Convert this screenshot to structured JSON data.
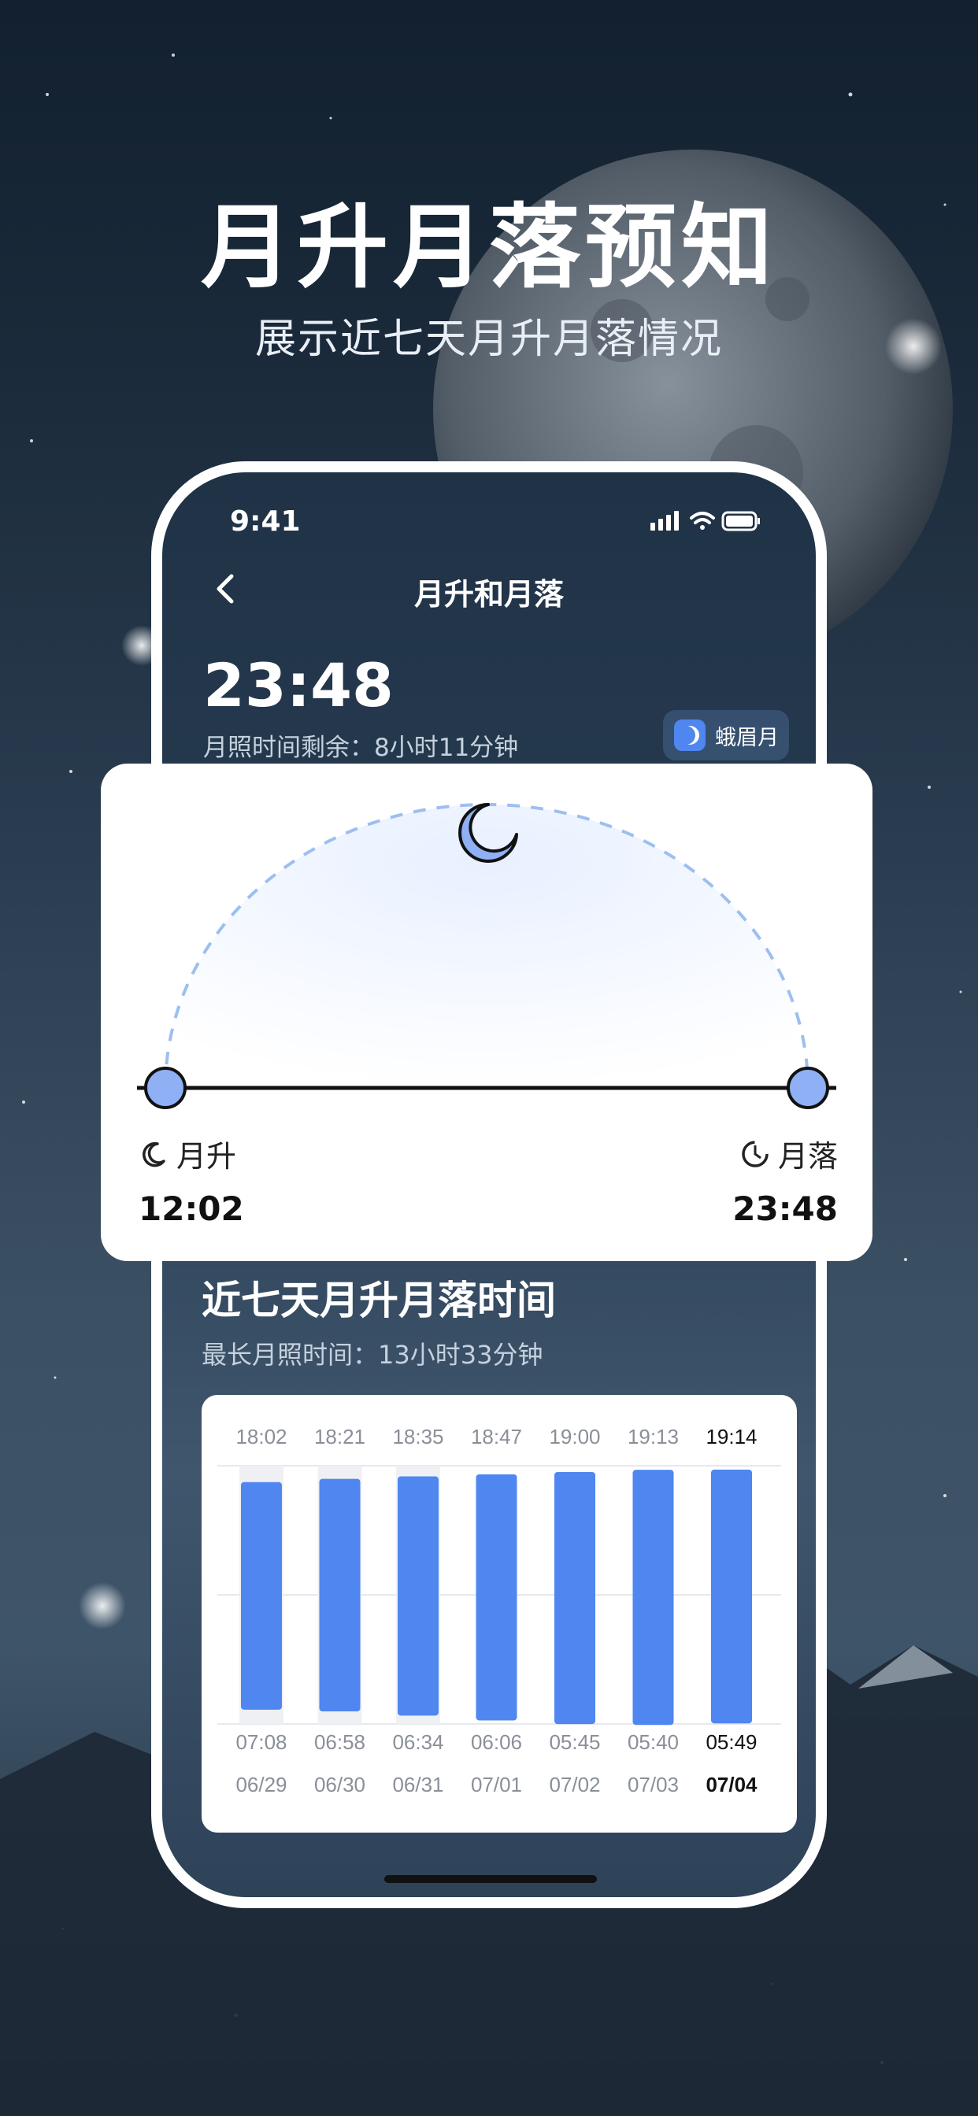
{
  "promo": {
    "title": "月升月落预知",
    "subtitle": "展示近七天月升月落情况"
  },
  "status_bar": {
    "time": "9:41"
  },
  "nav": {
    "title": "月升和月落",
    "back_icon": "chevron-left-icon"
  },
  "current": {
    "time": "23:48",
    "remaining": "月照时间剩余：8小时11分钟",
    "phase_label": "蛾眉月",
    "phase_icon": "moon-phase-icon"
  },
  "arc_card": {
    "rise_label": "月升",
    "rise_time": "12:02",
    "set_label": "月落",
    "set_time": "23:48",
    "moon_progress": 0.5
  },
  "section": {
    "title": "近七天月升月落时间",
    "subtitle": "最长月照时间：13小时33分钟"
  },
  "colors": {
    "accent": "#4f86f0",
    "arc_dash": "#9dbff0",
    "moon_fill": "#8fb0f5"
  },
  "chart_data": {
    "type": "bar",
    "categories": [
      "06/29",
      "06/30",
      "06/31",
      "07/01",
      "07/02",
      "07/03",
      "07/04"
    ],
    "rise_times": [
      "18:02",
      "18:21",
      "18:35",
      "18:47",
      "19:00",
      "19:13",
      "19:14"
    ],
    "set_times": [
      "07:08",
      "06:58",
      "06:34",
      "06:06",
      "05:45",
      "05:40",
      "05:49"
    ],
    "highlight_index": 6
  }
}
